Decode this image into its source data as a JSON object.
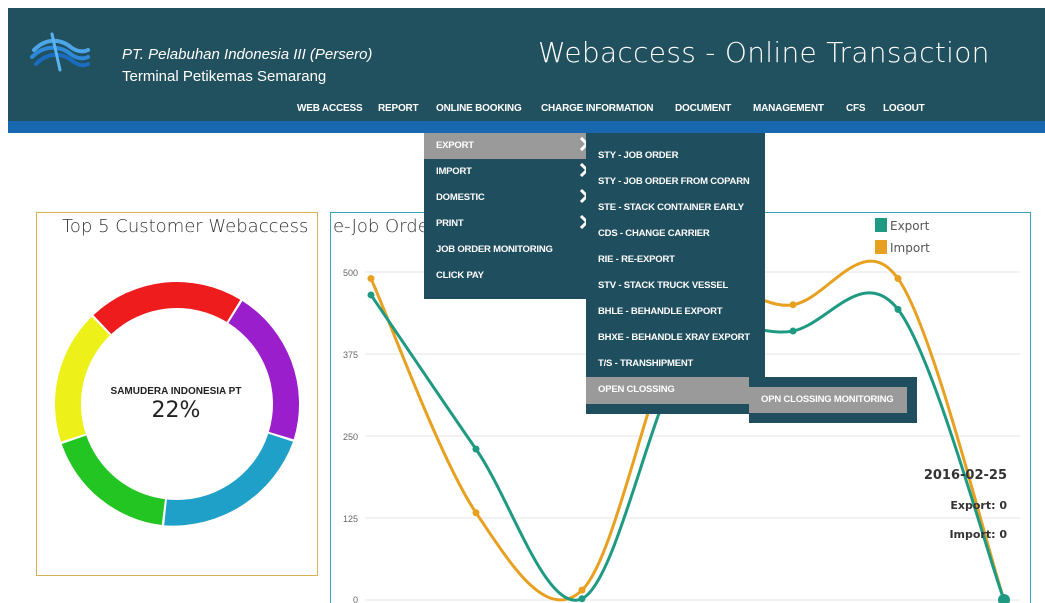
{
  "header": {
    "company": "PT. Pelabuhan Indonesia III (Persero)",
    "terminal": "Terminal Petikemas Semarang",
    "app_title": "Webaccess - Online Transaction",
    "logo_icon": "pelindo-wave-logo-icon",
    "bg_color": "#21505f",
    "accent_color": "#1868b0"
  },
  "nav": {
    "items": [
      "WEB ACCESS",
      "REPORT",
      "ONLINE BOOKING",
      "CHARGE INFORMATION",
      "DOCUMENT",
      "MANAGEMENT",
      "CFS",
      "LOGOUT"
    ]
  },
  "menu_level1": {
    "items": [
      "EXPORT",
      "IMPORT",
      "DOMESTIC",
      "PRINT",
      "JOB ORDER MONITORING",
      "CLICK PAY"
    ],
    "highlighted": "EXPORT"
  },
  "menu_level2": {
    "items": [
      "STY - JOB ORDER",
      "STY - JOB ORDER FROM COPARN",
      "STE - STACK CONTAINER EARLY",
      "CDS - CHANGE CARRIER",
      "RIE - RE-EXPORT",
      "STV - STACK TRUCK VESSEL",
      "BHLE - BEHANDLE EXPORT",
      "BHXE - BEHANDLE XRAY EXPORT",
      "T/S - TRANSHIPMENT",
      "OPEN CLOSSING"
    ],
    "highlighted": "OPEN CLOSSING"
  },
  "menu_level3": {
    "items": [
      "OPN CLOSSING MONITORING"
    ]
  },
  "left_panel": {
    "title": "Top 5 Customer Webaccess",
    "center_label": "SAMUDERA INDONESIA PT",
    "center_pct": "22%"
  },
  "right_panel": {
    "title": "e-Job Orde"
  },
  "tooltip": {
    "date": "2016-02-25",
    "export": "Export: 0",
    "import": "Import: 0"
  },
  "chart_data": [
    {
      "type": "pie",
      "title": "Top 5 Customer Webaccess",
      "slices": [
        {
          "color": "#1fa0c9",
          "value": 22,
          "label": "SAMUDERA INDONESIA PT"
        },
        {
          "color": "#22c522",
          "value": 18
        },
        {
          "color": "#eef01a",
          "value": 18
        },
        {
          "color": "#ee1c1c",
          "value": 21
        },
        {
          "color": "#9a1ecc",
          "value": 21
        }
      ]
    },
    {
      "type": "line",
      "title": "e-Job Orde",
      "ylim": [
        0,
        500
      ],
      "yticks": [
        "0",
        "125",
        "250",
        "375",
        "500"
      ],
      "series": [
        {
          "name": "Export",
          "color": "#1f9a82",
          "x": [
            0,
            1,
            2,
            3,
            4,
            5,
            6
          ],
          "values": [
            465,
            230,
            2,
            380,
            410,
            443,
            0
          ]
        },
        {
          "name": "Import",
          "color": "#e8a020",
          "x": [
            0,
            1,
            2,
            3,
            4,
            5,
            6
          ],
          "values": [
            490,
            133,
            15,
            440,
            450,
            490,
            0
          ]
        }
      ]
    }
  ]
}
